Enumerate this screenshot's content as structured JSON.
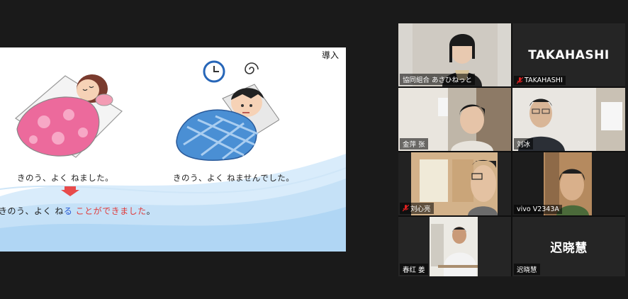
{
  "slide": {
    "tag": "導入",
    "caption_left": "きのう、よく ねました。",
    "caption_right": "きのう、よく ねませんでした。",
    "result_prefix": "きのう、よく ね",
    "result_blue": "る",
    "result_red": " ことができました",
    "result_suffix": "。"
  },
  "participants": [
    {
      "name": "協同組合 あさひねっと",
      "muted": false,
      "video": true,
      "active": true
    },
    {
      "name": "TAKAHASHI",
      "display": "TAKAHASHI",
      "muted": true,
      "video": false
    },
    {
      "name": "金萍 张",
      "muted": false,
      "video": true
    },
    {
      "name": "刘冰",
      "muted": false,
      "video": true
    },
    {
      "name": "刘心亮",
      "muted": true,
      "video": true
    },
    {
      "name": "vivo V2343A",
      "muted": false,
      "video": true
    },
    {
      "name": "春红 姜",
      "muted": false,
      "video": true
    },
    {
      "name": "迟晓慧",
      "display": "迟晓慧",
      "muted": false,
      "video": false
    }
  ],
  "colors": {
    "active_border": "#2ecc71",
    "blue_text": "#2a5cd6",
    "red_text": "#e03a3a",
    "muted_icon": "#e02020"
  },
  "icons": [
    "clock-icon",
    "mic-muted-icon",
    "down-arrow-icon",
    "dizzy-swirl-icon"
  ]
}
